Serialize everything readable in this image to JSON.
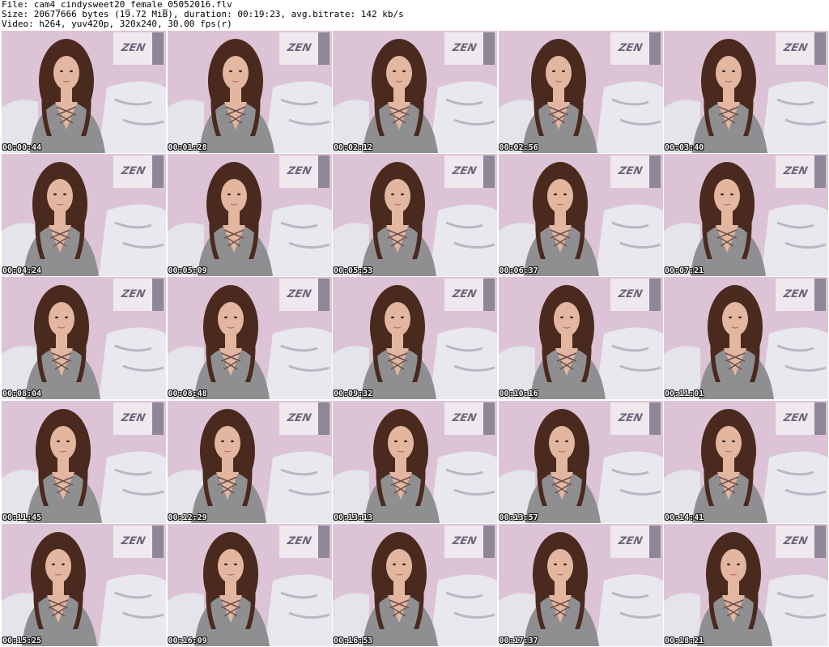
{
  "header": {
    "file_line": "File: cam4_cindysweet20_female_05052016.flv",
    "size_line": "Size: 20677666 bytes (19.72 MiB), duration: 00:19:23, avg.bitrate: 142 kb/s",
    "video_line": "Video: h264, yuv420p, 320x240, 30.00 fps(r)"
  },
  "poster_text": "ZEN",
  "colors": {
    "wall": "#dcc3d5",
    "poster": "#efe8ee",
    "blanket": "#e8e8ee",
    "top": "#8f8f92",
    "hair": "#4a2a1f",
    "skin": "#e3b6a0"
  },
  "thumbnails": [
    {
      "time": "00:00:44"
    },
    {
      "time": "00:01:28"
    },
    {
      "time": "00:02:12"
    },
    {
      "time": "00:02:56"
    },
    {
      "time": "00:03:40"
    },
    {
      "time": "00:04:24"
    },
    {
      "time": "00:05:09"
    },
    {
      "time": "00:05:53"
    },
    {
      "time": "00:06:37"
    },
    {
      "time": "00:07:21"
    },
    {
      "time": "00:08:04"
    },
    {
      "time": "00:08:48"
    },
    {
      "time": "00:09:32"
    },
    {
      "time": "00:10:16"
    },
    {
      "time": "00:11:01"
    },
    {
      "time": "00:11:45"
    },
    {
      "time": "00:12:29"
    },
    {
      "time": "00:13:13"
    },
    {
      "time": "00:13:57"
    },
    {
      "time": "00:14:41"
    },
    {
      "time": "00:15:25"
    },
    {
      "time": "00:16:09"
    },
    {
      "time": "00:16:53"
    },
    {
      "time": "00:17:37"
    },
    {
      "time": "00:18:21"
    }
  ]
}
